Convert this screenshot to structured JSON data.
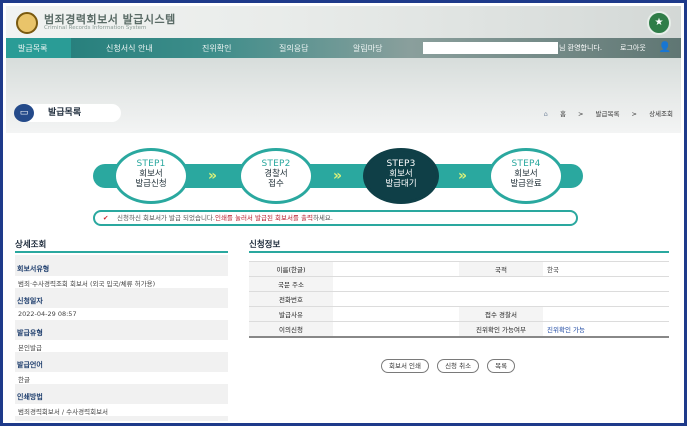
{
  "header": {
    "title": "범죄경력회보서 발급시스템",
    "subtitle": "Criminal Records Information System"
  },
  "nav": {
    "items": [
      "발급목록",
      "신청서식 안내",
      "진위확인",
      "질의응답",
      "알림마당"
    ],
    "welcome": "님 환영합니다.",
    "logout": "로그아웃"
  },
  "page": {
    "title": "발급목록",
    "breadcrumb": [
      "홈",
      ">",
      "발급목록",
      ">",
      "상세조회"
    ]
  },
  "steps": [
    {
      "num": "STEP1",
      "line1": "회보서",
      "line2": "발급신청",
      "active": false
    },
    {
      "num": "STEP2",
      "line1": "경찰서",
      "line2": "접수",
      "active": false
    },
    {
      "num": "STEP3",
      "line1": "회보서",
      "line2": "발급대기",
      "active": true
    },
    {
      "num": "STEP4",
      "line1": "회보서",
      "line2": "발급완료",
      "active": false
    }
  ],
  "notice": {
    "before": "신청하신 회보서가 발급 되었습니다.",
    "highlight": "인쇄를 눌러서 발급된 회보서를 출력",
    "after": "하세요."
  },
  "detail": {
    "heading": "상세조회",
    "fields": [
      {
        "label": "회보서유형",
        "value": "범죄·수사경력조회 회보서 (외국 입국/체류 허가용)"
      },
      {
        "label": "신청일자",
        "value": "2022-04-29 08:57"
      },
      {
        "label": "발급유형",
        "value": "본인발급"
      },
      {
        "label": "발급언어",
        "value": "한글"
      },
      {
        "label": "인쇄방법",
        "value": "범죄경력회보서 / 수사경력회보서"
      }
    ]
  },
  "info": {
    "heading": "신청정보",
    "rows": [
      {
        "k1": "이름(한글)",
        "v1": "",
        "k2": "국적",
        "v2": "한국"
      },
      {
        "k1": "국문 주소",
        "v1": "",
        "k2": "",
        "v2": ""
      },
      {
        "k1": "전화번호",
        "v1": "",
        "k2": "",
        "v2": ""
      },
      {
        "k1": "발급사유",
        "v1": "",
        "k2": "접수 경찰서",
        "v2": ""
      },
      {
        "k1": "이의신청",
        "v1": "",
        "k2": "진위확인 가능여부",
        "v2": "진위확인 가능"
      }
    ]
  },
  "buttons": [
    "회보서 인쇄",
    "신청 취소",
    "목록"
  ],
  "colors": {
    "teal": "#2aa89f",
    "navy": "#0f3f47",
    "accent_red": "#b81c2c"
  }
}
